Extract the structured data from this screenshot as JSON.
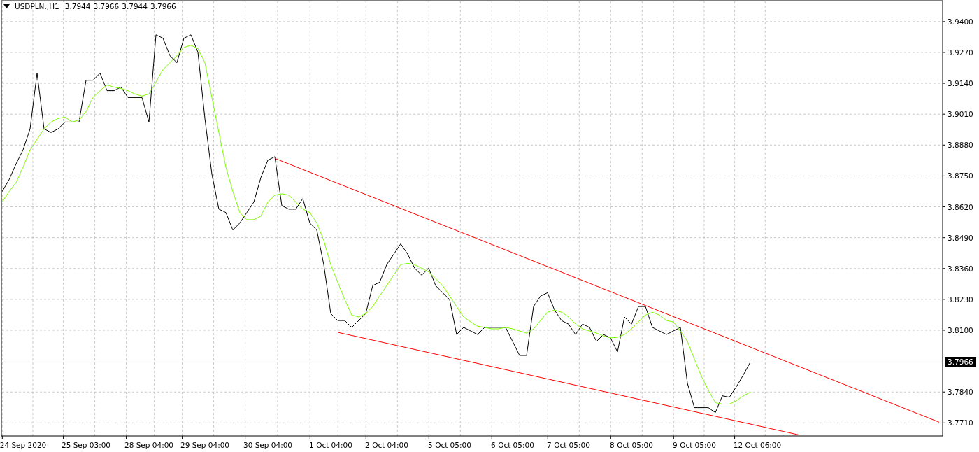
{
  "header": {
    "symbol": "USDPLN.,H1",
    "quotes": [
      "3.7944",
      "3.7966",
      "3.7944",
      "3.7966"
    ]
  },
  "chart_data": {
    "type": "line",
    "grid": true,
    "categories": [
      null,
      null,
      null,
      "24 Sep 2020",
      null,
      null,
      null,
      null,
      null,
      null,
      null,
      null,
      "25 Sep 03:00",
      null,
      null,
      null,
      null,
      null,
      null,
      null,
      null,
      "28 Sep 04:00",
      null,
      null,
      null,
      null,
      null,
      null,
      null,
      "29 Sep 04:00",
      null,
      null,
      null,
      null,
      null,
      null,
      null,
      null,
      "30 Sep 04:00",
      null,
      null,
      null,
      null,
      null,
      null,
      null,
      null,
      "1 Oct 04:00",
      null,
      null,
      null,
      null,
      null,
      null,
      null,
      "2 Oct 04:00",
      null,
      null,
      null,
      null,
      null,
      null,
      null,
      null,
      "5 Oct 05:00",
      null,
      null,
      null,
      null,
      null,
      null,
      null,
      null,
      "6 Oct 05:00",
      null,
      null,
      null,
      null,
      null,
      null,
      null,
      "7 Oct 05:00",
      null,
      null,
      null,
      null,
      null,
      null,
      null,
      null,
      "8 Oct 05:00",
      null,
      null,
      null,
      null,
      null,
      null,
      null,
      null,
      "9 Oct 05:00",
      null,
      null,
      null,
      null,
      null,
      null,
      null,
      null,
      "12 Oct 06:00",
      null,
      null,
      null,
      null,
      null,
      null,
      null,
      null,
      null,
      null,
      null,
      null,
      null,
      null,
      null,
      null,
      null,
      null,
      null,
      null,
      null,
      null,
      null,
      null,
      null,
      null
    ],
    "series": [
      {
        "color": "#000000",
        "values": [
          3.8684,
          3.8734,
          3.8801,
          3.886,
          3.8948,
          3.9183,
          3.8948,
          3.8933,
          3.8948,
          3.8977,
          3.8977,
          3.8977,
          3.9153,
          3.9153,
          3.9183,
          3.9109,
          3.9109,
          3.9124,
          3.908,
          3.908,
          3.908,
          3.8977,
          3.9344,
          3.933,
          3.9256,
          3.9227,
          3.933,
          3.9344,
          3.9271,
          3.8992,
          3.8757,
          3.861,
          3.8596,
          3.8522,
          3.8552,
          3.8596,
          3.864,
          3.8743,
          3.8816,
          3.8831,
          3.8625,
          3.861,
          3.861,
          3.8655,
          3.8552,
          3.8522,
          3.8376,
          3.817,
          3.8141,
          3.8141,
          3.8112,
          3.8141,
          3.817,
          3.8288,
          3.8302,
          3.8376,
          3.842,
          3.8464,
          3.842,
          3.8361,
          3.8332,
          3.8361,
          3.8288,
          3.8258,
          3.8229,
          3.8082,
          3.8112,
          3.8097,
          3.8082,
          3.8112,
          3.8112,
          3.8112,
          3.8112,
          3.8053,
          3.7994,
          3.7994,
          3.82,
          3.8244,
          3.8258,
          3.8185,
          3.8141,
          3.8126,
          3.8082,
          3.8126,
          3.8112,
          3.8053,
          3.8082,
          3.8068,
          3.8009,
          3.8156,
          3.8126,
          3.82,
          3.82,
          3.8112,
          3.8097,
          3.8082,
          3.8097,
          3.8112,
          3.7877,
          3.7774,
          3.7774,
          3.7774,
          3.7753,
          3.7824,
          3.7818,
          3.7862,
          3.7912,
          3.7966,
          null,
          null,
          null,
          null,
          null,
          null,
          null,
          null,
          null,
          null,
          null,
          null,
          null,
          null,
          null,
          null,
          null,
          null,
          null,
          null,
          null,
          null,
          null,
          null,
          null,
          null,
          null
        ]
      },
      {
        "color": "#7cfc00",
        "values": [
          3.864,
          3.8684,
          3.8722,
          3.8787,
          3.886,
          3.8904,
          3.8948,
          3.8977,
          3.8992,
          3.8998,
          3.8977,
          3.8986,
          3.9021,
          3.908,
          3.9109,
          3.9133,
          3.9124,
          3.9118,
          3.9109,
          3.9095,
          3.9086,
          3.9095,
          3.9145,
          3.9197,
          3.9227,
          3.9256,
          3.9291,
          3.93,
          3.9286,
          3.9227,
          3.908,
          3.8933,
          3.8787,
          3.8684,
          3.8596,
          3.8566,
          3.8566,
          3.8581,
          3.864,
          3.8669,
          3.8675,
          3.8669,
          3.864,
          3.861,
          3.8596,
          3.8552,
          3.8478,
          3.8376,
          3.8302,
          3.8229,
          3.8164,
          3.8156,
          3.817,
          3.82,
          3.8244,
          3.8288,
          3.8332,
          3.8376,
          3.8382,
          3.8376,
          3.8361,
          3.8346,
          3.8317,
          3.8288,
          3.8244,
          3.82,
          3.8156,
          3.8135,
          3.8117,
          3.8112,
          3.8106,
          3.8106,
          3.8112,
          3.8106,
          3.8097,
          3.8088,
          3.8106,
          3.8141,
          3.8176,
          3.8185,
          3.8176,
          3.8156,
          3.8126,
          3.8106,
          3.8097,
          3.8088,
          3.8076,
          3.8068,
          3.807,
          3.8082,
          3.8106,
          3.8135,
          3.8164,
          3.8176,
          3.8164,
          3.8141,
          3.8135,
          3.8097,
          3.8053,
          3.7979,
          3.7906,
          3.7847,
          3.7795,
          3.7789,
          3.7789,
          3.7803,
          3.7824,
          3.7839,
          null,
          null,
          null,
          null,
          null,
          null,
          null,
          null,
          null,
          null,
          null,
          null,
          null,
          null,
          null,
          null,
          null,
          null,
          null,
          null,
          null,
          null,
          null,
          null,
          null,
          null,
          null
        ]
      },
      {
        "color": "#ff0000",
        "values": [
          null,
          null,
          null,
          null,
          null,
          null,
          null,
          null,
          null,
          null,
          null,
          null,
          null,
          null,
          null,
          null,
          null,
          null,
          null,
          null,
          null,
          null,
          null,
          null,
          null,
          null,
          null,
          null,
          null,
          null,
          null,
          null,
          null,
          null,
          null,
          null,
          null,
          null,
          null,
          3.8824,
          null,
          null,
          null,
          null,
          null,
          null,
          null,
          null,
          null,
          null,
          null,
          null,
          null,
          null,
          null,
          null,
          null,
          null,
          null,
          null,
          null,
          null,
          null,
          null,
          null,
          null,
          null,
          null,
          null,
          null,
          null,
          null,
          null,
          null,
          null,
          null,
          null,
          null,
          null,
          null,
          null,
          null,
          null,
          null,
          null,
          null,
          null,
          null,
          null,
          null,
          null,
          null,
          null,
          null,
          null,
          null,
          null,
          null,
          null,
          null,
          null,
          null,
          null,
          null,
          null,
          null,
          null,
          null,
          null,
          null,
          null,
          null,
          null,
          null,
          null,
          null,
          null,
          null,
          null,
          null,
          null,
          null,
          null,
          null,
          null,
          null,
          null,
          null,
          null,
          null,
          null,
          null,
          null,
          null,
          3.7713
        ]
      },
      {
        "color": "#ff0000",
        "values": [
          null,
          null,
          null,
          null,
          null,
          null,
          null,
          null,
          null,
          null,
          null,
          null,
          null,
          null,
          null,
          null,
          null,
          null,
          null,
          null,
          null,
          null,
          null,
          null,
          null,
          null,
          null,
          null,
          null,
          null,
          null,
          null,
          null,
          null,
          null,
          null,
          null,
          null,
          null,
          null,
          null,
          null,
          null,
          null,
          null,
          null,
          null,
          null,
          3.8091,
          null,
          null,
          null,
          null,
          null,
          null,
          null,
          null,
          null,
          null,
          null,
          null,
          null,
          null,
          null,
          null,
          null,
          null,
          null,
          null,
          null,
          null,
          null,
          null,
          null,
          null,
          null,
          null,
          null,
          null,
          null,
          null,
          null,
          null,
          null,
          null,
          null,
          null,
          null,
          null,
          null,
          null,
          null,
          null,
          null,
          null,
          null,
          null,
          null,
          null,
          null,
          null,
          null,
          null,
          null,
          null,
          null,
          null,
          null,
          null,
          null,
          null,
          null,
          null,
          null,
          3.7659,
          null,
          null,
          null,
          null,
          null,
          null,
          null,
          null,
          null,
          null,
          null,
          null,
          null,
          null,
          null,
          null,
          null,
          null,
          null,
          null
        ]
      }
    ],
    "ylim": [
      3.7655,
      3.9485
    ],
    "yticks": [
      {
        "value": 3.94,
        "label": "3.9400"
      },
      {
        "value": 3.927,
        "label": "3.9270"
      },
      {
        "value": 3.914,
        "label": "3.9140"
      },
      {
        "value": 3.901,
        "label": "3.9010"
      },
      {
        "value": 3.888,
        "label": "3.8880"
      },
      {
        "value": 3.875,
        "label": "3.8750"
      },
      {
        "value": 3.862,
        "label": "3.8620"
      },
      {
        "value": 3.849,
        "label": "3.8490"
      },
      {
        "value": 3.836,
        "label": "3.8360"
      },
      {
        "value": 3.823,
        "label": "3.8230"
      },
      {
        "value": 3.81,
        "label": "3.8100"
      },
      {
        "value": 3.784,
        "label": "3.7840"
      },
      {
        "value": 3.771,
        "label": "3.7710"
      }
    ],
    "ref_lines": [
      {
        "axis": "y",
        "value": 3.7966,
        "label": "3.7966"
      }
    ]
  }
}
